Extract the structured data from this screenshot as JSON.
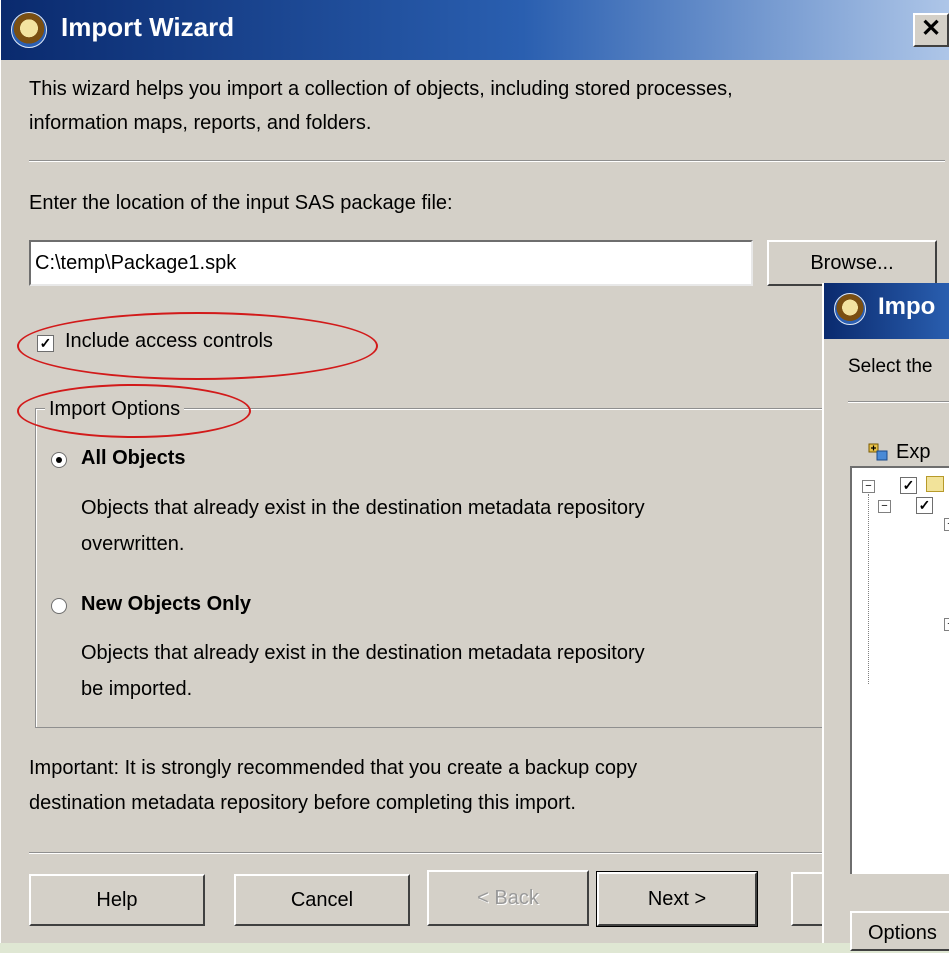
{
  "window": {
    "title": "Import Wizard",
    "close_label": "✕",
    "intro_line1": "This wizard helps you import a collection of objects, including stored processes,",
    "intro_line2": "information maps, reports, and folders.",
    "location_label": "Enter the location of the input SAS package file:",
    "file_path": "C:\\temp\\Package1.spk",
    "browse_label": "Browse...",
    "include_access_label": "Include access controls",
    "include_access_checked": true,
    "import_options": {
      "legend": "Import Options",
      "all_objects": {
        "label": "All Objects",
        "desc_line1": "Objects that already exist in the destination metadata repository",
        "desc_line2": "overwritten.",
        "selected": true
      },
      "new_objects": {
        "label": "New Objects Only",
        "desc_line1": "Objects that already exist in the destination metadata repository",
        "desc_line2": "be imported.",
        "selected": false
      }
    },
    "important_line1": "Important: It is strongly recommended that you create a backup copy",
    "important_line2": "destination metadata repository before completing this import.",
    "buttons": {
      "help": "Help",
      "cancel": "Cancel",
      "back": "< Back",
      "next": "Next >"
    }
  },
  "overlay_window": {
    "title": "Impo",
    "select_text": "Select the",
    "expand_label": "Exp",
    "options_label": "Options"
  },
  "colors": {
    "annotation": "#d21a1a",
    "titlebar_start": "#0a2a6e",
    "titlebar_end": "#aec6e8"
  },
  "icons": [
    "wizard-icon",
    "close-icon",
    "checkbox-checked-icon",
    "radio-selected-icon",
    "radio-unselected-icon",
    "expand-icon",
    "folder-icon"
  ]
}
